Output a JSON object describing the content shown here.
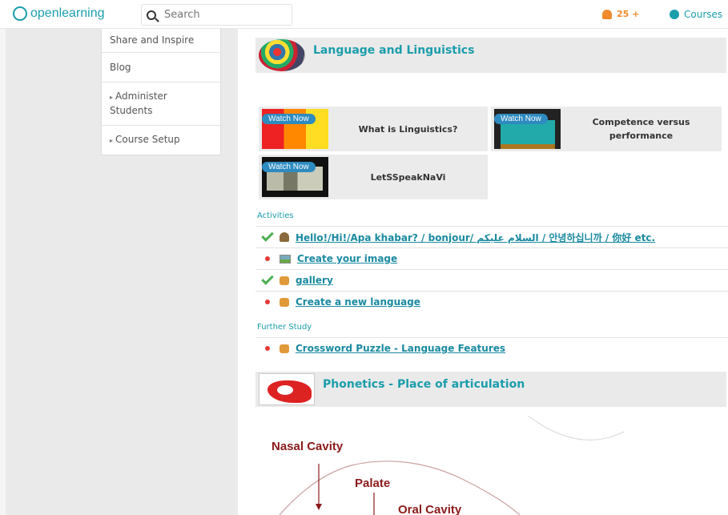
{
  "header": {
    "logo_text": "openlearning",
    "search_placeholder": "Search",
    "notifications": "25 +",
    "courses": "Courses"
  },
  "sidebar": {
    "items": [
      {
        "label": "Share and Inspire"
      },
      {
        "label": "Blog"
      },
      {
        "label": "Administer Students",
        "arrow": "▸"
      },
      {
        "label": "Course Setup",
        "arrow": "▸"
      }
    ]
  },
  "section1": {
    "title": "Language and Linguistics",
    "videos": [
      {
        "watch": "Watch Now",
        "title": "What is Linguistics?"
      },
      {
        "watch": "Watch Now",
        "title": "Competence versus performance"
      },
      {
        "watch": "Watch Now",
        "title": "LetSSpeakNaVi"
      }
    ],
    "activities_label": "Activities",
    "activities": [
      {
        "status": "done",
        "icon": "person-icon",
        "title": "Hello!/Hi!/Apa khabar? / bonjour/ السلام عليكم / 안녕하십니까 / 你好 etc."
      },
      {
        "status": "todo",
        "icon": "image-icon",
        "title": "Create your image"
      },
      {
        "status": "done",
        "icon": "puzzle-icon",
        "title": "gallery"
      },
      {
        "status": "todo",
        "icon": "puzzle-icon",
        "title": "Create a new language"
      }
    ],
    "further_label": "Further Study",
    "further": [
      {
        "status": "todo",
        "icon": "puzzle-icon",
        "title": "Crossword Puzzle - Language Features"
      }
    ]
  },
  "section2": {
    "title": "Phonetics - Place of articulation",
    "diagram_labels": {
      "nasal": "Nasal Cavity",
      "palate": "Palate",
      "oral": "Oral Cavity"
    }
  }
}
